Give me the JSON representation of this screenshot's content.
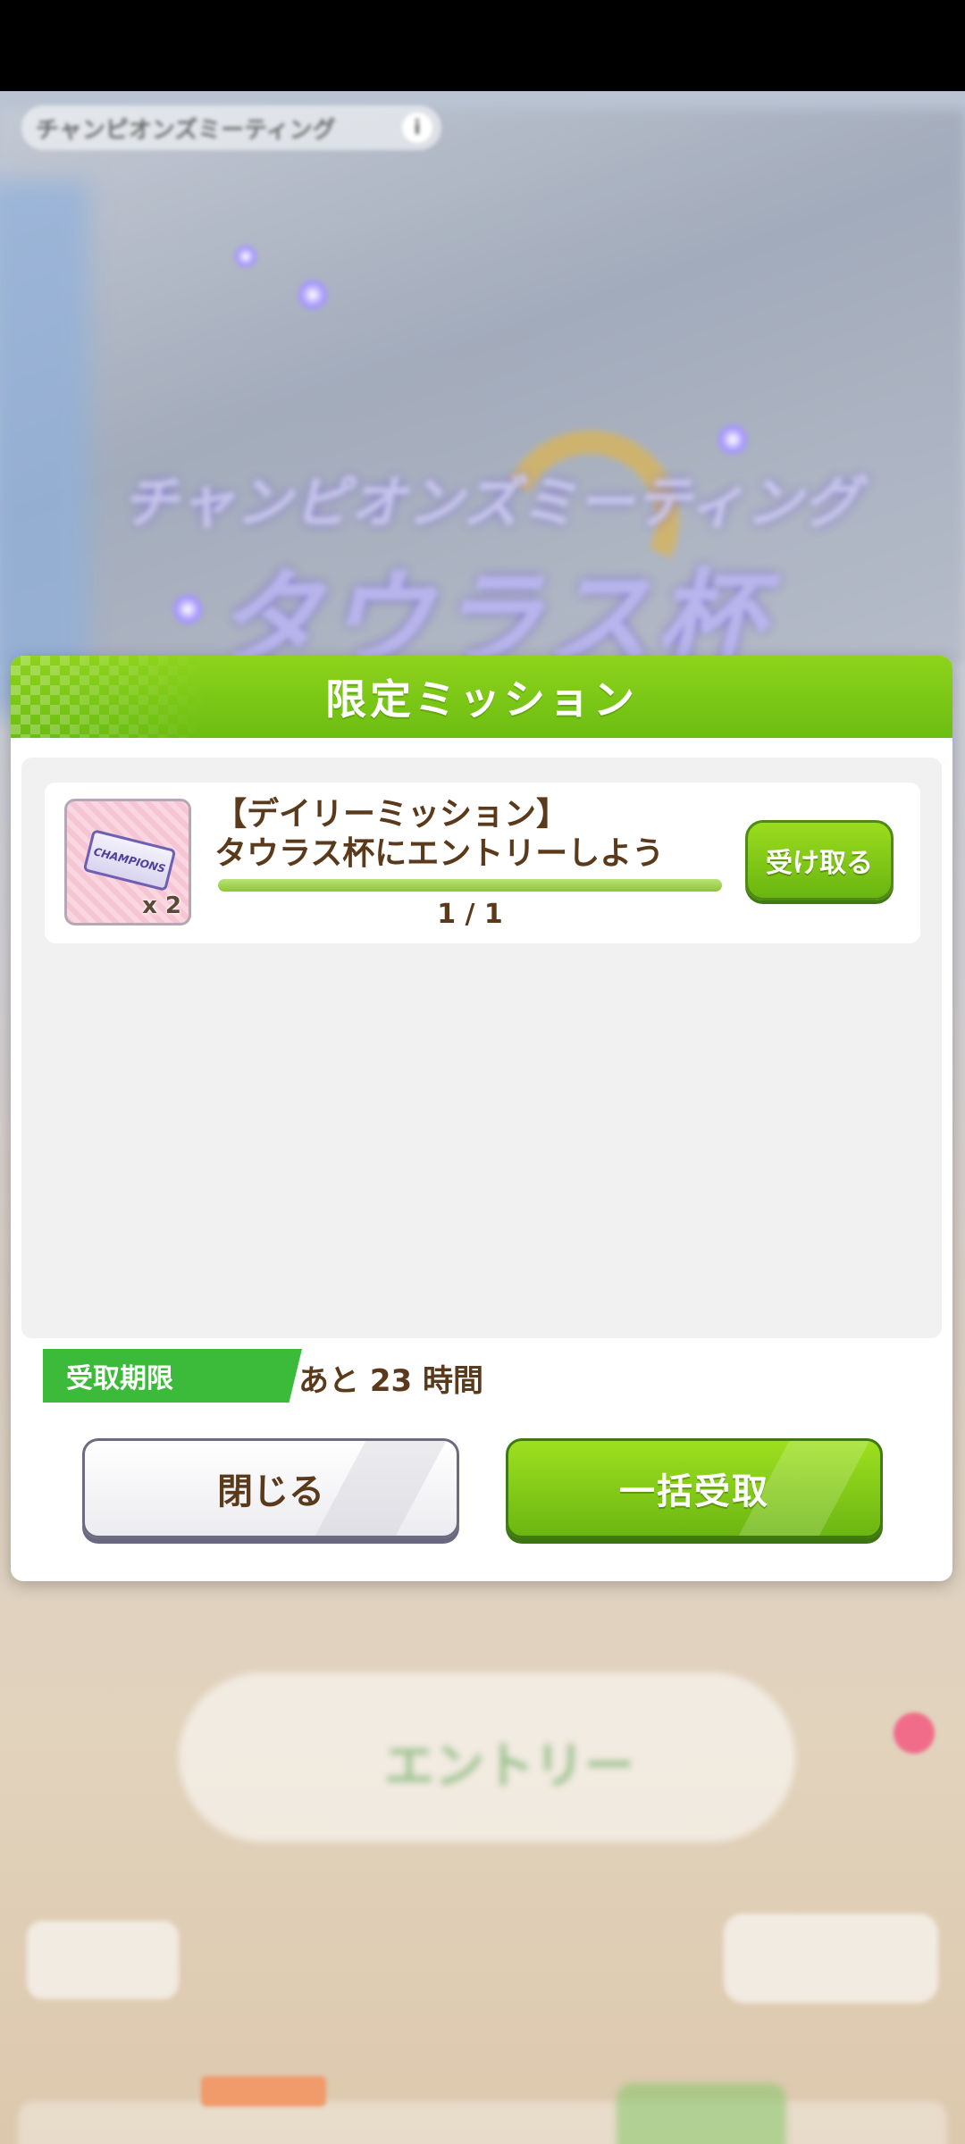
{
  "background": {
    "top_pill_label": "チャンピオンズミーティング",
    "top_pill_badge": "i",
    "event_title_line1": "チャンピオンズミーティング",
    "event_title_line2": "タウラス杯",
    "entry_label": "エントリー"
  },
  "modal": {
    "title": "限定ミッション",
    "missions": [
      {
        "title_line1": "【デイリーミッション】",
        "title_line2": "タウラス杯にエントリーしよう",
        "reward_item": "CHAMPIONS",
        "reward_count": "x 2",
        "progress_text": "1 / 1",
        "progress_fraction": 1.0,
        "claim_label": "受け取る"
      }
    ],
    "deadline_label": "受取期限",
    "deadline_value": "あと 23 時間",
    "close_label": "閉じる",
    "bulk_claim_label": "一括受取"
  },
  "colors": {
    "accent_green": "#6cbd12",
    "text_brown": "#5b3a1c",
    "deadline_green": "#3cbb3a"
  }
}
